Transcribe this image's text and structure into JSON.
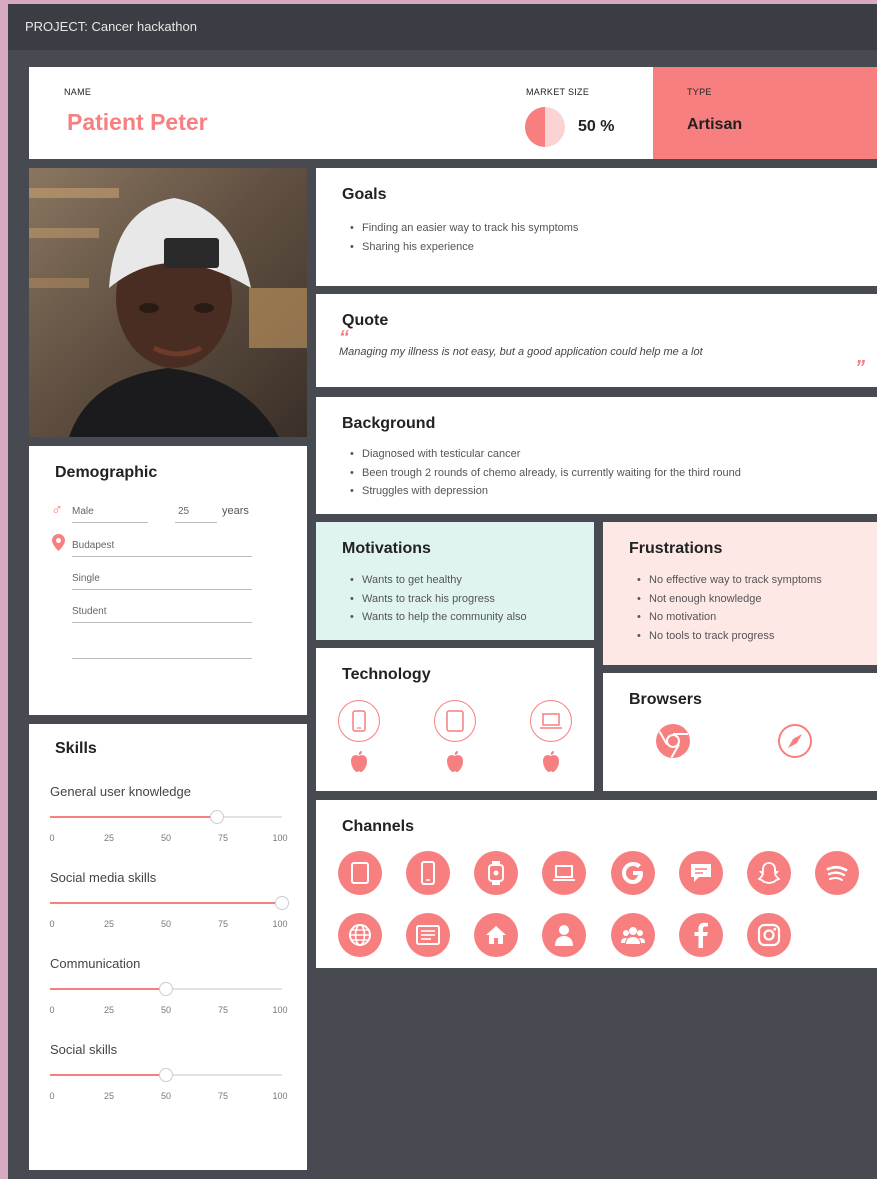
{
  "project": {
    "label": "PROJECT: Cancer hackathon"
  },
  "header": {
    "name_label": "NAME",
    "name": "Patient Peter",
    "market_label": "MARKET SIZE",
    "market_value": "50 %",
    "market_fraction": 0.5,
    "type_label": "TYPE",
    "type_value": "Artisan"
  },
  "goals": {
    "title": "Goals",
    "items": [
      "Finding an easier way to track his symptoms",
      "Sharing his experience"
    ]
  },
  "quote": {
    "title": "Quote",
    "open_mark": "“",
    "close_mark": "”",
    "text": "Managing my illness is not easy, but a good application could help me a lot"
  },
  "background": {
    "title": "Background",
    "items": [
      "Diagnosed with testicular cancer",
      "Been trough 2 rounds of chemo already, is currently waiting for the third round",
      "Struggles with depression"
    ]
  },
  "demographic": {
    "title": "Demographic",
    "gender": "Male",
    "age": "25",
    "age_unit": "years",
    "location": "Budapest",
    "status": "Single",
    "occupation": "Student",
    "extra": ""
  },
  "motivations": {
    "title": "Motivations",
    "items": [
      "Wants to get healthy",
      "Wants to track his progress",
      "Wants to help the community also"
    ]
  },
  "frustrations": {
    "title": "Frustrations",
    "items": [
      "No effective way to track symptoms",
      "Not enough knowledge",
      "No motivation",
      "No tools to track progress"
    ]
  },
  "technology": {
    "title": "Technology",
    "devices": [
      "phone-icon",
      "tablet-icon",
      "laptop-icon"
    ],
    "platform_icon": "apple-icon"
  },
  "browsers": {
    "title": "Browsers",
    "items": [
      "chrome-icon",
      "safari-icon"
    ]
  },
  "skills": {
    "title": "Skills",
    "ticks": [
      "0",
      "25",
      "50",
      "75",
      "100"
    ],
    "items": [
      {
        "label": "General user knowledge",
        "value": 72
      },
      {
        "label": "Social media skills",
        "value": 100
      },
      {
        "label": "Communication",
        "value": 50
      },
      {
        "label": "Social skills",
        "value": 50
      }
    ]
  },
  "channels": {
    "title": "Channels",
    "icons": [
      "tablet-icon",
      "phone-icon",
      "watch-icon",
      "laptop-icon",
      "google-icon",
      "message-icon",
      "snapchat-icon",
      "spotify-icon",
      "web-icon",
      "news-icon",
      "home-icon",
      "person-icon",
      "community-icon",
      "facebook-icon",
      "instagram-icon"
    ]
  },
  "colors": {
    "accent": "#f77f80",
    "motivation_bg": "#dff4f0",
    "frustration_bg": "#fde8e6",
    "dark_bg": "#474a51"
  }
}
